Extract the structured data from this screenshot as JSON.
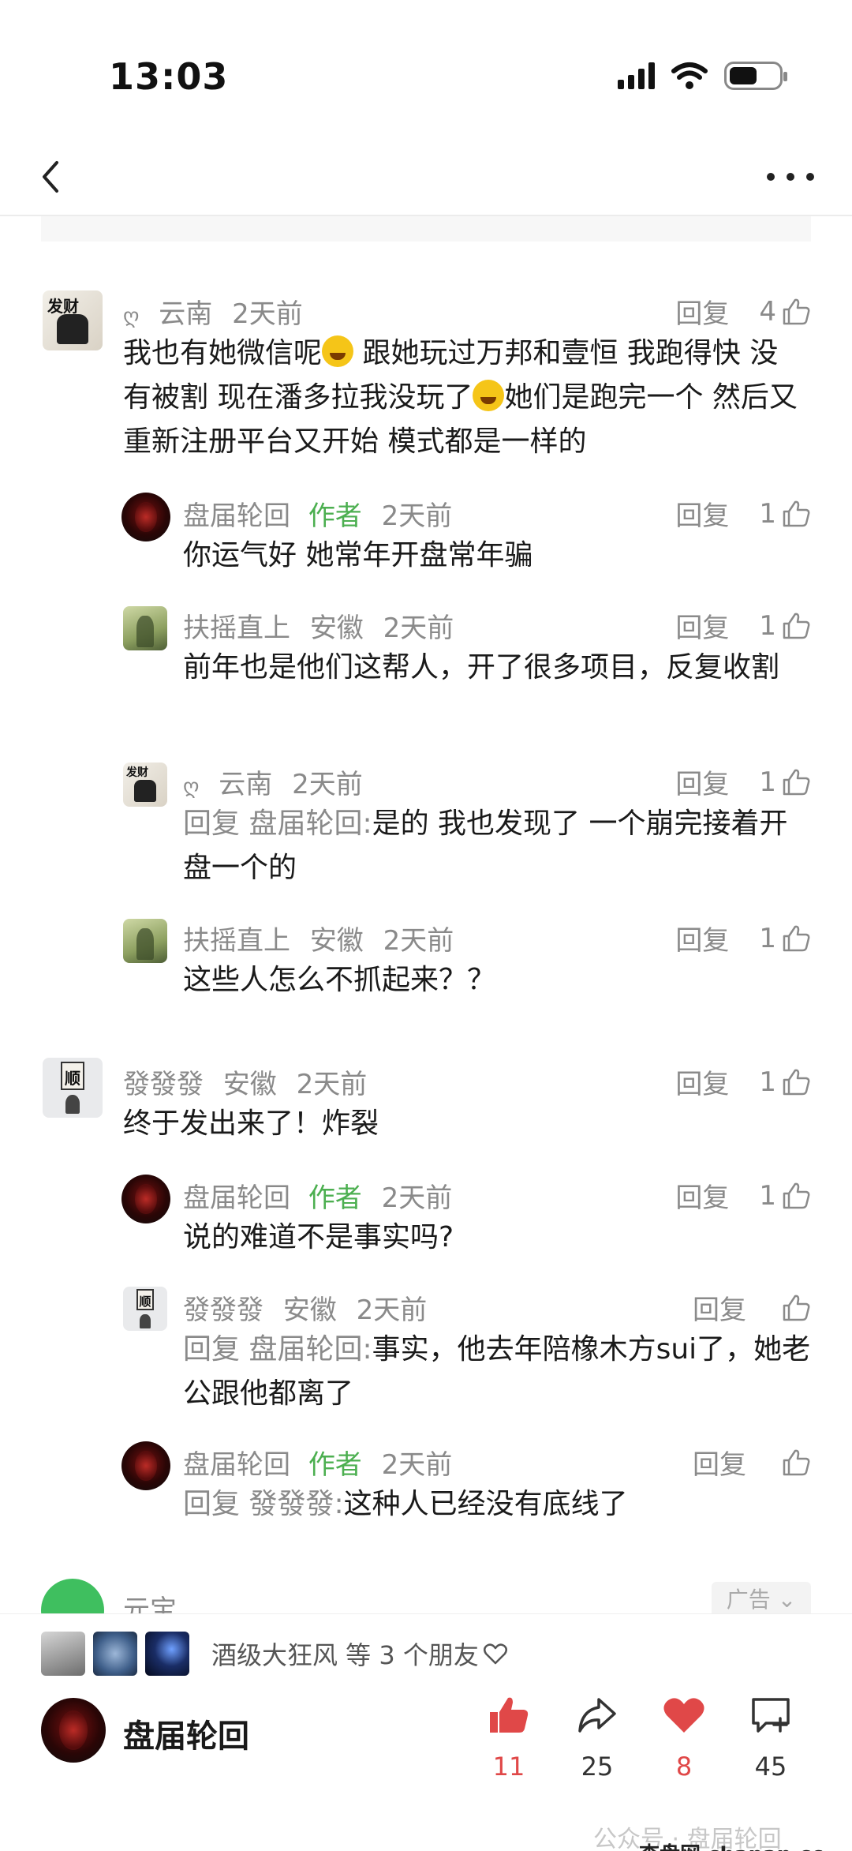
{
  "status": {
    "time": "13:03"
  },
  "comments": [
    {
      "user": "云南",
      "location": "",
      "time": "2天前",
      "reply_label": "回复",
      "likes": "4",
      "text_parts": [
        "我也有她微信呢",
        " 跟她玩过万邦和壹恒 我跑得快 没有被割 现在潘多拉我没玩了",
        "她们是跑完一个 然后又重新注册平台又开始 模式都是一样的"
      ]
    },
    {
      "user": "盘届轮回",
      "author_tag": "作者",
      "time": "2天前",
      "reply_label": "回复",
      "likes": "1",
      "text": "你运气好  她常年开盘常年骗"
    },
    {
      "user": "扶摇直上",
      "location": "安徽",
      "time": "2天前",
      "reply_label": "回复",
      "likes": "1",
      "text": "前年也是他们这帮人，开了很多项目，反复收割"
    },
    {
      "user": "云南",
      "time": "2天前",
      "reply_label": "回复",
      "likes": "1",
      "quote": "回复 盘届轮回:",
      "text": "是的 我也发现了 一个崩完接着开盘一个的"
    },
    {
      "user": "扶摇直上",
      "location": "安徽",
      "time": "2天前",
      "reply_label": "回复",
      "likes": "1",
      "text": "这些人怎么不抓起来？？"
    },
    {
      "user": "發發發",
      "location": "安徽",
      "time": "2天前",
      "reply_label": "回复",
      "likes": "1",
      "text": "终于发出来了！炸裂"
    },
    {
      "user": "盘届轮回",
      "author_tag": "作者",
      "time": "2天前",
      "reply_label": "回复",
      "likes": "1",
      "text": "说的难道不是事实吗?"
    },
    {
      "user": "發發發",
      "location": "安徽",
      "time": "2天前",
      "reply_label": "回复",
      "likes": "",
      "quote": "回复 盘届轮回:",
      "text": "事实，他去年陪橡木方sui了，她老公跟他都离了"
    },
    {
      "user": "盘届轮回",
      "author_tag": "作者",
      "time": "2天前",
      "reply_label": "回复",
      "likes": "",
      "quote": "回复 發發發:",
      "text": "这种人已经没有底线了"
    }
  ],
  "avatar_text": {
    "fa": "发财",
    "shun": "顺"
  },
  "ad": {
    "name": "元宝",
    "tag": "广告"
  },
  "bottom": {
    "friends_text": "酒级大狂风 等 3 个朋友",
    "author_name": "盘届轮回",
    "like_count": "11",
    "share_count": "25",
    "heart_count": "8",
    "comment_count": "45",
    "watermark": "公众号 · 盘届轮回",
    "site": "查盘网 chapan.cc"
  },
  "colors": {
    "author_tag": "#4caf50",
    "heart": "#e04848",
    "like": "#e04848"
  },
  "icons": [
    "chevron-left-icon",
    "more-icon",
    "thumb-up-icon",
    "share-icon",
    "heart-icon",
    "comment-add-icon",
    "gear-icon"
  ]
}
